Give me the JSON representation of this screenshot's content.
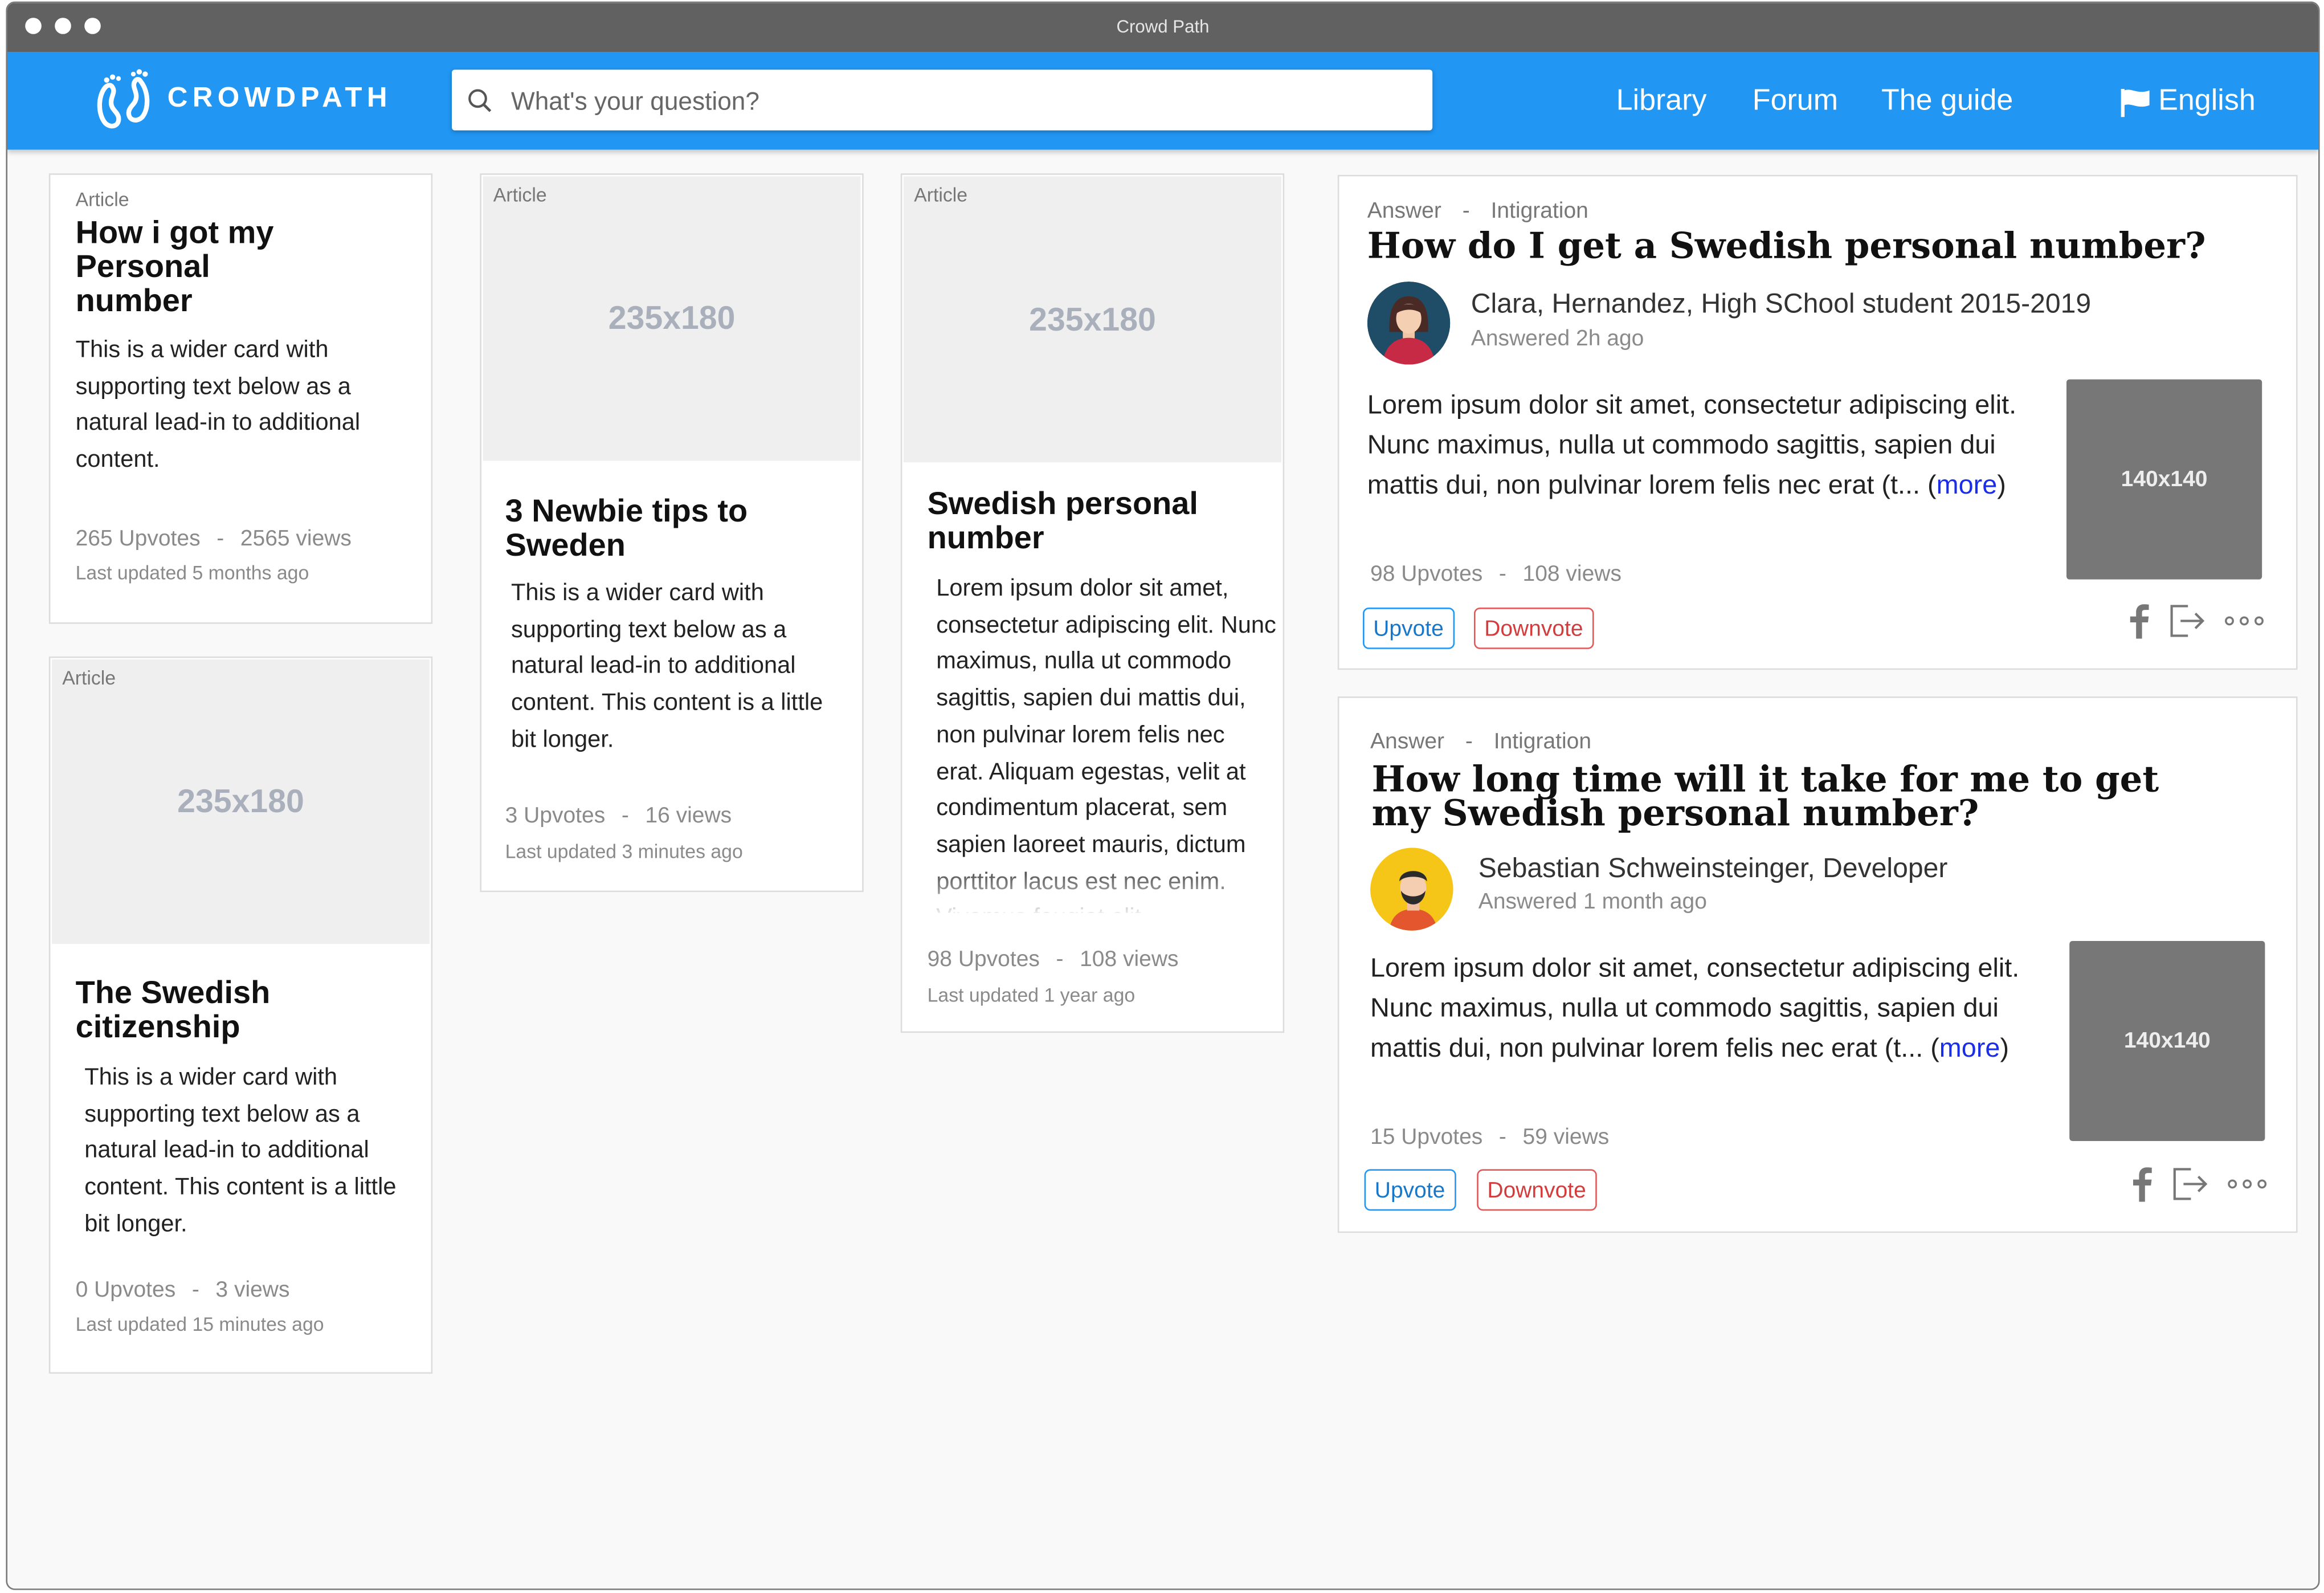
{
  "window": {
    "title": "Crowd Path"
  },
  "brand": {
    "name": "CROWDPATH"
  },
  "search": {
    "placeholder": "What's your question?"
  },
  "nav": {
    "library": "Library",
    "forum": "Forum",
    "guide": "The guide",
    "language": "English"
  },
  "colors": {
    "primary": "#2196f3",
    "upvote": "#2196f3",
    "downvote": "#e05858"
  },
  "articles": [
    {
      "badge": "Article",
      "title": "How i got my Personal number",
      "text": "This is a wider card with supporting text below as a natural lead-in to additional content.",
      "upvotes": "265 Upvotes",
      "views": "2565 views",
      "updated": "Last updated 5 months ago"
    },
    {
      "badge": "Article",
      "image": "235x180",
      "title": "3 Newbie tips to Sweden",
      "text": "This is a wider card with supporting text below as a natural lead-in to additional content. This content is a little bit longer.",
      "upvotes": "3 Upvotes",
      "views": "16 views",
      "updated": "Last updated 3 minutes ago"
    },
    {
      "badge": "Article",
      "image": "235x180",
      "title": "Swedish personal number",
      "text": "Lorem ipsum dolor sit amet, consectetur adipiscing elit. Nunc maximus, nulla ut commodo sagittis, sapien dui mattis dui, non pulvinar lorem felis nec erat. Aliquam egestas, velit at condimentum placerat, sem sapien laoreet mauris, dictum porttitor lacus est nec enim. Vivamus feugiat elit",
      "upvotes": "98 Upvotes",
      "views": "108 views",
      "updated": "Last updated 1 year ago"
    },
    {
      "badge": "Article",
      "image": "235x180",
      "title": "The Swedish citizenship",
      "text": "This is a wider card with supporting text below as a natural lead-in to additional content. This content is a little bit longer.",
      "upvotes": "0 Upvotes",
      "views": "3 views",
      "updated": "Last updated 15 minutes ago"
    }
  ],
  "answers": [
    {
      "type": "Answer",
      "category": "Intigration",
      "separator": "-",
      "title": "How do I get a Swedish personal number?",
      "author": "Clara, Hernandez, High SChool student 2015-2019",
      "answered": "Answered 2h ago",
      "text": "Lorem ipsum dolor sit amet, consectetur adipiscing elit. Nunc maximus, nulla ut commodo sagittis, sapien dui mattis dui, non pulvinar lorem felis nec erat (t... (",
      "more": "more",
      "close": ")",
      "image": "140x140",
      "upvotes": "98 Upvotes",
      "views": "108 views",
      "upvote_label": "Upvote",
      "downvote_label": "Downvote"
    },
    {
      "type": "Answer",
      "category": "Intigration",
      "separator": "-",
      "title": "How long time will it take for me to get my Swedish personal number?",
      "author": "Sebastian Schweinsteinger, Developer",
      "answered": "Answered 1 month ago",
      "text": "Lorem ipsum dolor sit amet, consectetur adipiscing elit. Nunc maximus, nulla ut commodo sagittis, sapien dui mattis dui, non pulvinar lorem felis nec erat (t... (",
      "more": "more",
      "close": ")",
      "image": "140x140",
      "upvotes": "15 Upvotes",
      "views": "59 views",
      "upvote_label": "Upvote",
      "downvote_label": "Downvote"
    }
  ],
  "stats_separator": "-",
  "icons": [
    "search-icon",
    "flag-icon",
    "facebook-icon",
    "share-icon",
    "more-icon"
  ]
}
